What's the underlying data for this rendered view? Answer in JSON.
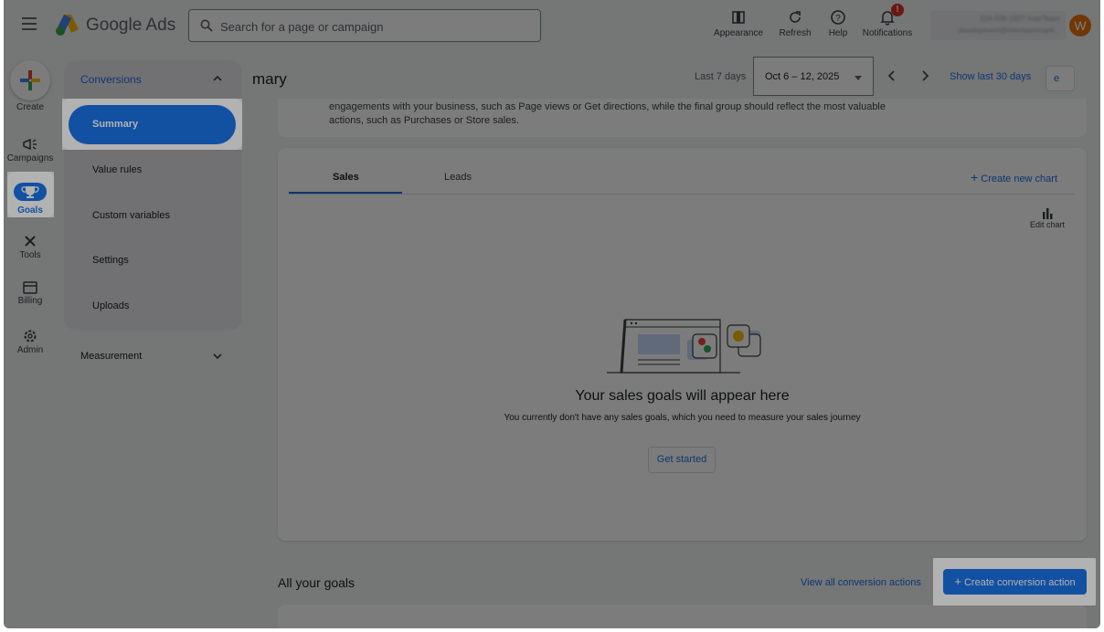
{
  "topbar": {
    "brand": "Google Ads",
    "search_placeholder": "Search for a page or campaign",
    "tools": [
      {
        "label": "Appearance",
        "icon": "appearance-icon"
      },
      {
        "label": "Refresh",
        "icon": "refresh-icon"
      },
      {
        "label": "Help",
        "icon": "help-icon"
      },
      {
        "label": "Notifications",
        "icon": "bell-icon",
        "badge": "!"
      }
    ],
    "account": {
      "line1": "524-596-1827 InterTeam",
      "line2": "development@interteammark..."
    },
    "avatar_letter": "W"
  },
  "rail": {
    "create": "Create",
    "campaigns": "Campaigns",
    "goals": "Goals",
    "tools": "Tools",
    "billing": "Billing",
    "admin": "Admin"
  },
  "subnav": {
    "section": "Conversions",
    "items": [
      "Summary",
      "Value rules",
      "Custom variables",
      "Settings",
      "Uploads"
    ],
    "measurement": "Measurement"
  },
  "header": {
    "title": "mary",
    "period_label": "Last 7 days",
    "date_range": "Oct 6 – 12, 2025",
    "show_last_30": "Show last 30 days",
    "partial_button": "e"
  },
  "intro": {
    "line1": "engagements with your business, such as Page views or Get directions, while the final group should reflect the most valuable",
    "line2": "actions, such as Purchases or Store sales."
  },
  "chart_card": {
    "tabs": [
      "Sales",
      "Leads"
    ],
    "create_new_chart": "Create new chart",
    "edit_chart": "Edit chart",
    "empty_title": "Your sales goals will appear here",
    "empty_sub": "You currently don't have any sales goals, which you need to measure your sales journey",
    "get_started": "Get started"
  },
  "bottom": {
    "all_goals": "All your goals",
    "view_all": "View all conversion actions",
    "create_conversion": "Create conversion action"
  },
  "colors": {
    "accent": "#1a73e8",
    "dim": "rgba(0,0,0,0.30)"
  }
}
